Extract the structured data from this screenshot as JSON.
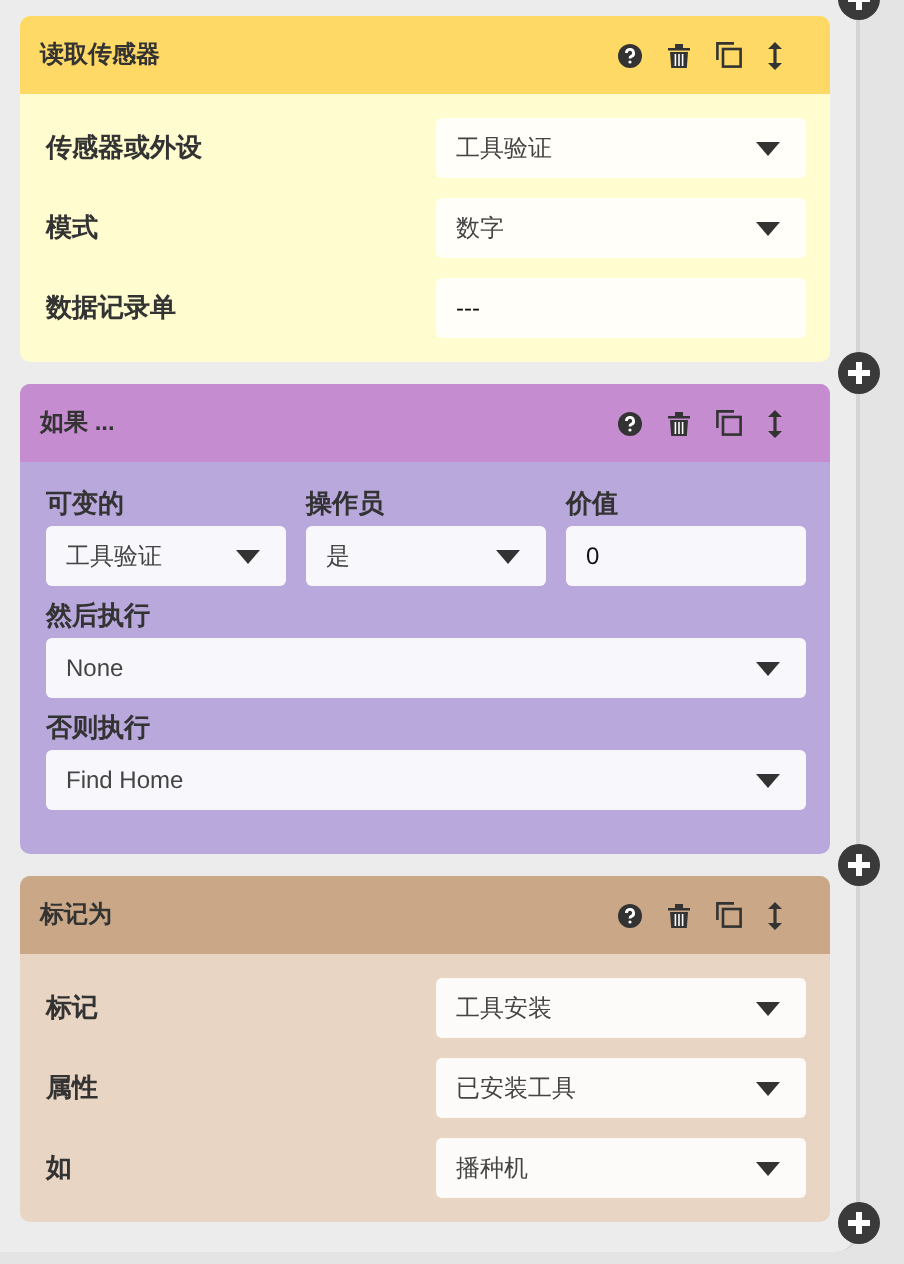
{
  "steps": [
    {
      "kind": "read_sensor",
      "title": "读取传感器",
      "fields": [
        {
          "kind": "select",
          "label": "传感器或外设",
          "value": "工具验证"
        },
        {
          "kind": "select",
          "label": "模式",
          "value": "数字"
        },
        {
          "kind": "input",
          "label": "数据记录单",
          "value": "---"
        }
      ]
    },
    {
      "kind": "if",
      "title": "如果 ...",
      "inline_fields": [
        {
          "kind": "select",
          "label": "可变的",
          "value": "工具验证"
        },
        {
          "kind": "select",
          "label": "操作员",
          "value": "是"
        },
        {
          "kind": "input",
          "label": "价值",
          "value": "0"
        }
      ],
      "fields": [
        {
          "kind": "select",
          "label": "然后执行",
          "value": "None"
        },
        {
          "kind": "select",
          "label": "否则执行",
          "value": "Find Home"
        }
      ]
    },
    {
      "kind": "mark_as",
      "title": "标记为",
      "fields": [
        {
          "kind": "select",
          "label": "标记",
          "value": "工具安装"
        },
        {
          "kind": "select",
          "label": "属性",
          "value": "已安装工具"
        },
        {
          "kind": "select",
          "label": "如",
          "value": "播种机"
        }
      ]
    }
  ]
}
